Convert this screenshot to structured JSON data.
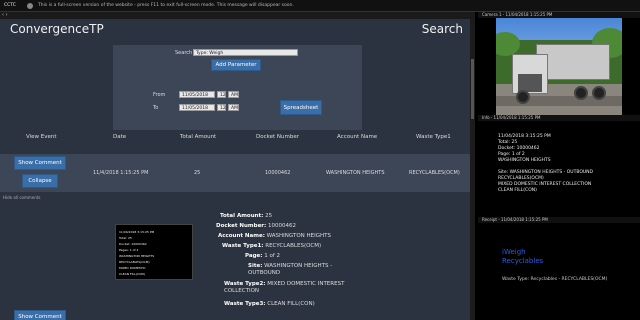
{
  "browser": {
    "title": "CCTC",
    "message": "This is a full-screen version of the website - press F11 to exit full-screen mode. This message will disappear soon."
  },
  "nav": {
    "arrows": "‹ ›"
  },
  "app": {
    "title": "ConvergenceTP",
    "search_link": "Search"
  },
  "filters": {
    "search_label": "Search",
    "search_value": "Type: Weigh",
    "add_parameter": "Add Parameter",
    "from_label": "From",
    "from_date": "11/05/2018",
    "from_hour": "12",
    "from_ampm": "AM",
    "to_label": "To",
    "to_date": "11/05/2018",
    "to_hour": "12",
    "to_ampm": "AM",
    "spreadsheet": "Spreadsheet"
  },
  "table": {
    "headers": [
      "View Event",
      "Date",
      "Total Amount",
      "Docket Number",
      "Account Name",
      "Waste Type1"
    ],
    "row": {
      "show_comment": "Show Comment",
      "collapse": "Collapse",
      "date": "11/4/2018 1:15:25 PM",
      "total_amount": "25",
      "docket_number": "10000462",
      "account_name": "WASHINGTON HEIGHTS",
      "waste_type": "RECYCLABLES(OCM)"
    }
  },
  "tiny_note": "Hide all comments",
  "detail": {
    "thumb_lines": [
      "11/04/2018 3:15:25 PM",
      "Total: 25",
      "Docket: 10000462",
      "Pages: 1 of 2",
      "WASHINGTON HEIGHTS",
      "RECYCLABLES(OCM)",
      "MIXED DOMESTIC",
      "CLEAN FILL(CON)"
    ],
    "fields": [
      {
        "label": "Total Amount:",
        "value": "25"
      },
      {
        "label": "Docket Number:",
        "value": "10000462"
      },
      {
        "label": "Account Name:",
        "value": "WASHINGTON HEIGHTS"
      },
      {
        "label": "Waste Type1:",
        "value": "RECYCLABLES(OCM)"
      },
      {
        "label": "Page:",
        "value": "1 of 2"
      },
      {
        "label": "Site:",
        "value": "WASHINGTON HEIGHTS - OUTBOUND"
      },
      {
        "label": "Waste Type2:",
        "value": "MIXED DOMESTIC INTEREST COLLECTION"
      },
      {
        "label": "Waste Type3:",
        "value": "CLEAN FILL(CON)"
      }
    ],
    "show_comment": "Show Comment"
  },
  "right": {
    "pane1_title": "Camera 1 - 11/04/2018 1:15:25 PM",
    "pane2_title": "Info - 11/04/2018 1:15:25 PM",
    "info_lines": [
      "11/04/2018 3:15:25 PM",
      "Total: 25",
      "Docket: 10000462",
      "Page: 1 of 2",
      "WASHINGTON HEIGHTS",
      "",
      "Site: WASHINGTON HEIGHTS - OUTBOUND",
      "RECYCLABLES(OCM)",
      "MIXED DOMESTIC INTEREST COLLECTION",
      "CLEAN FILL(CON)"
    ],
    "pane3_title": "Receipt - 11/04/2018 1:15:25 PM",
    "brand_line1": "iWeigh",
    "brand_line2": "Recyclables",
    "brand_sub": "Waste Type: Recyclables - RECYCLABLES(OCM)"
  }
}
